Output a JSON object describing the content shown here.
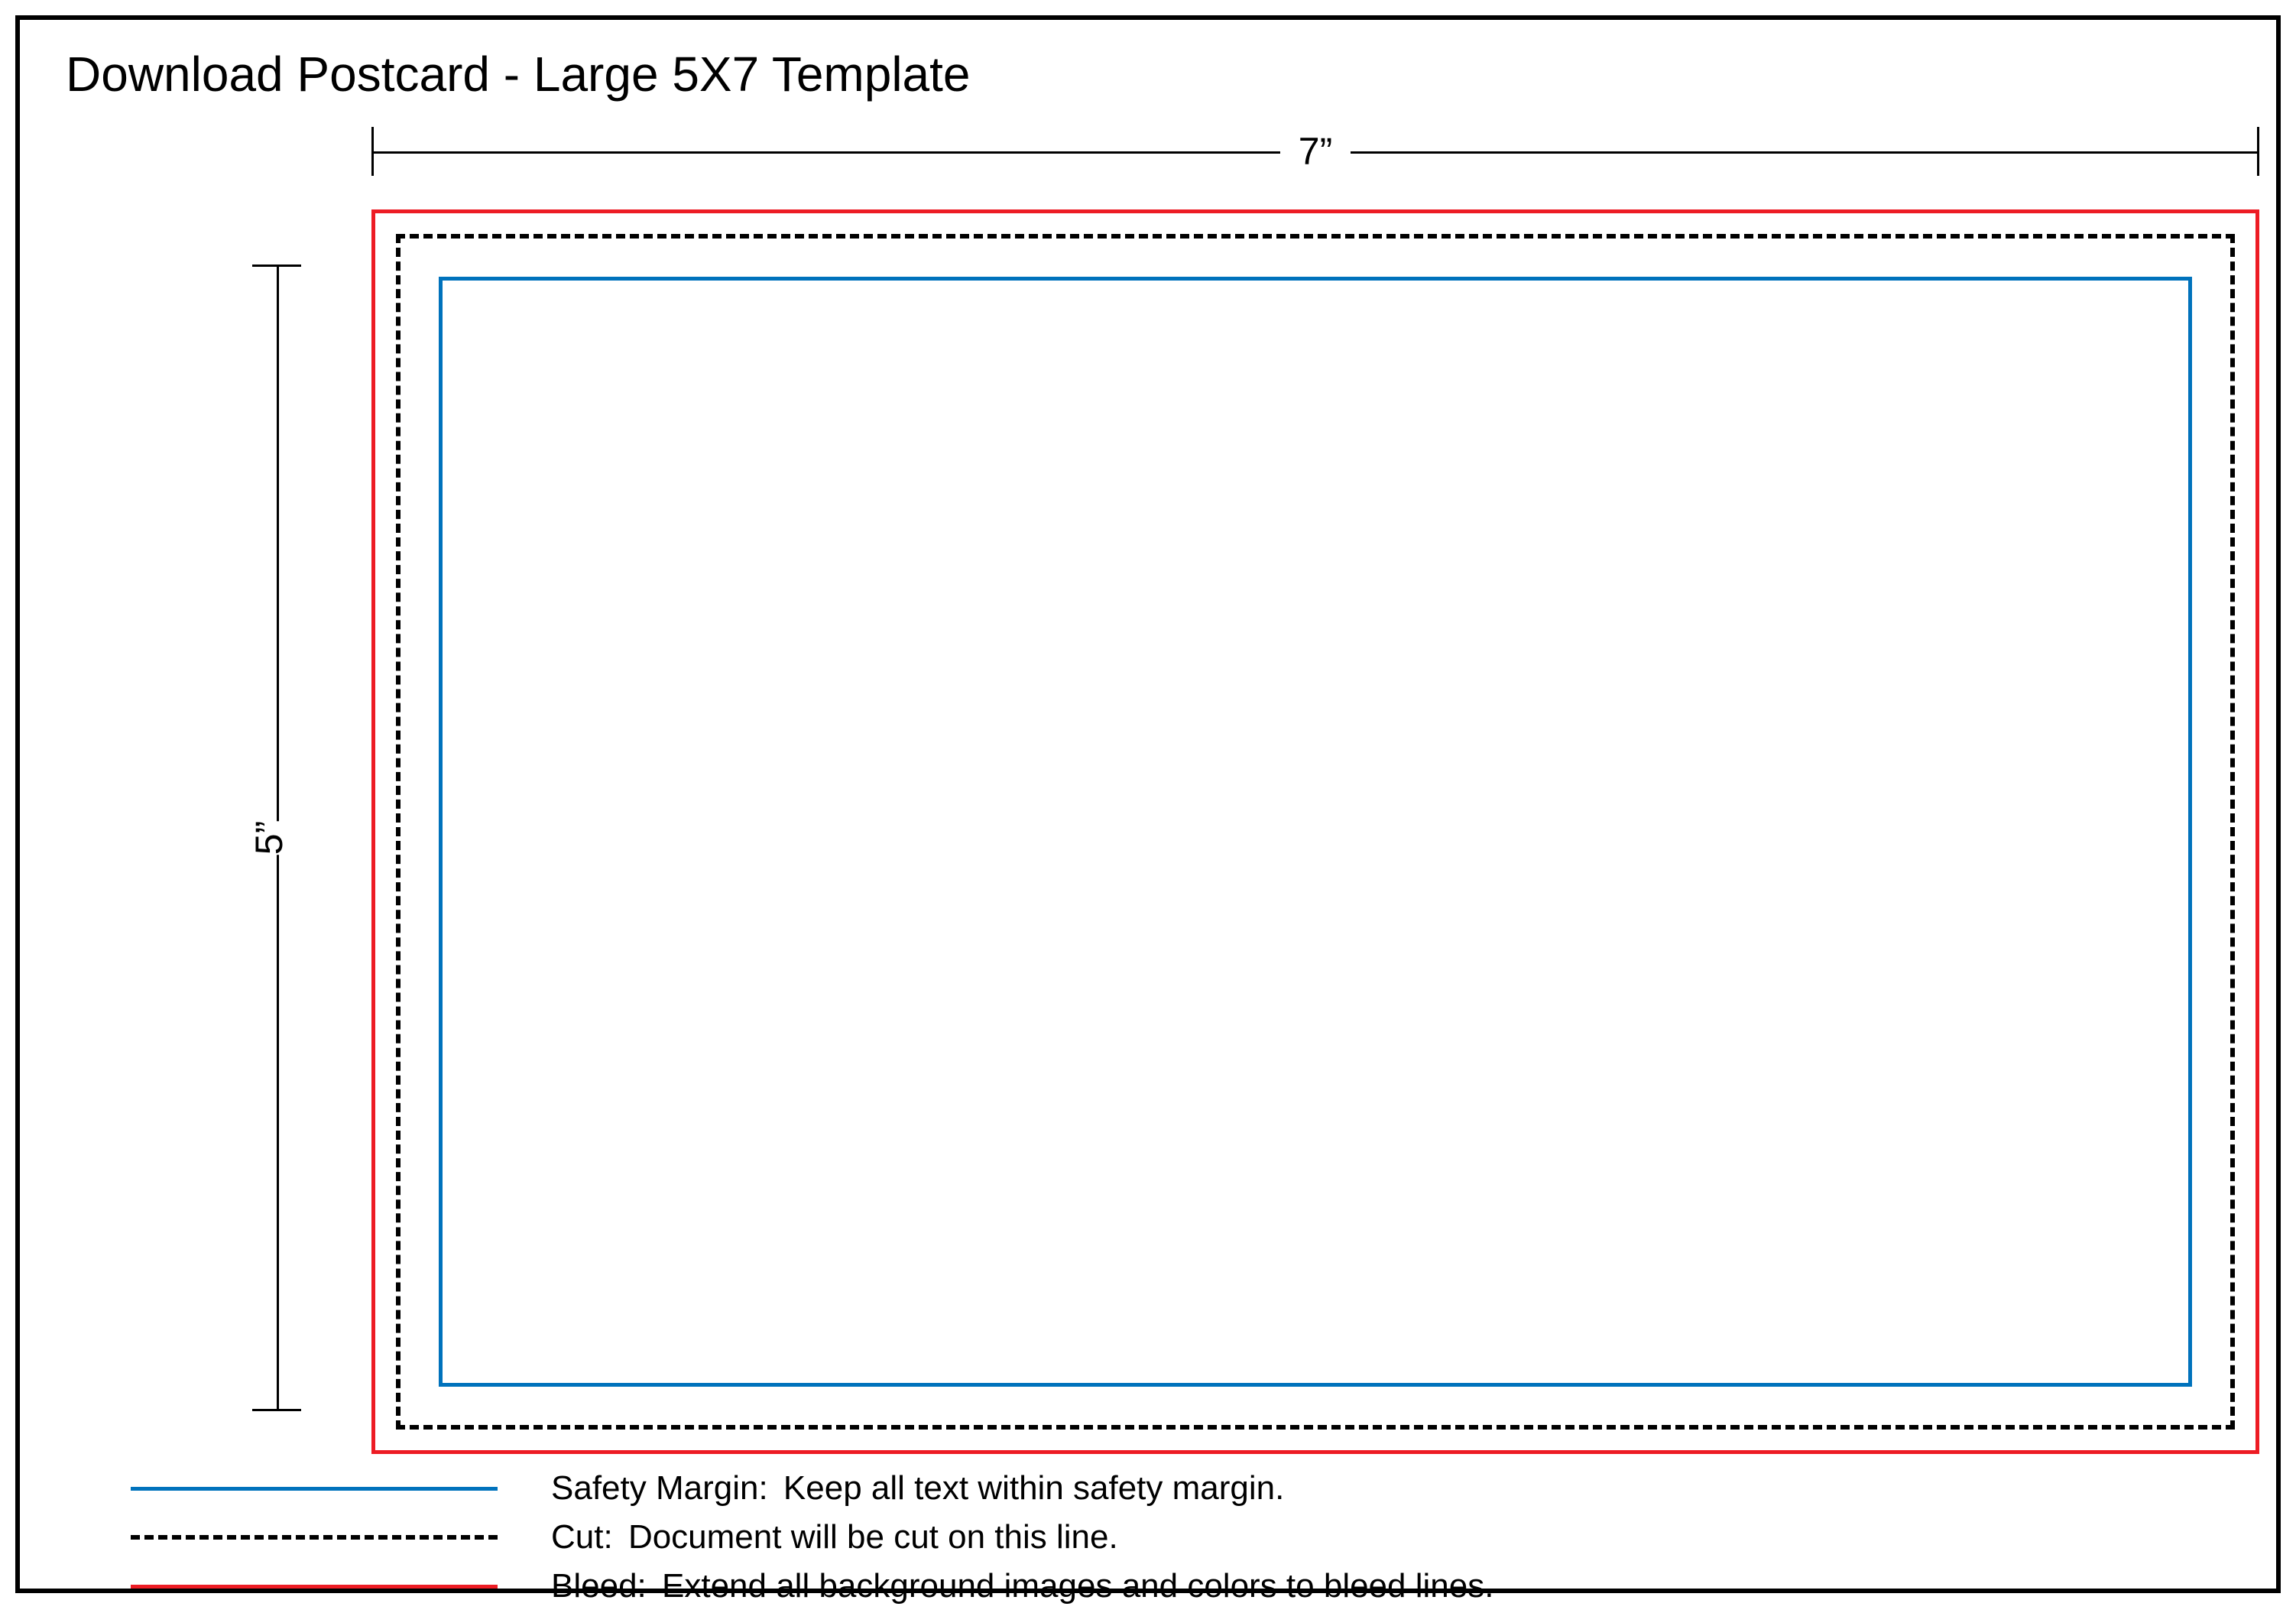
{
  "title": "Download Postcard - Large 5X7 Template",
  "dimensions": {
    "width_label": "7”",
    "height_label": "5”"
  },
  "colors": {
    "bleed": "#ed1c24",
    "cut": "#000000",
    "safety": "#0072bc"
  },
  "legend": {
    "safety": {
      "label": "Safety Margin:",
      "desc": "Keep all text within safety margin."
    },
    "cut": {
      "label": "Cut:",
      "desc": "Document will be cut on this line."
    },
    "bleed": {
      "label": "Bleed:",
      "desc": "Extend all background images and colors to bleed lines."
    }
  }
}
